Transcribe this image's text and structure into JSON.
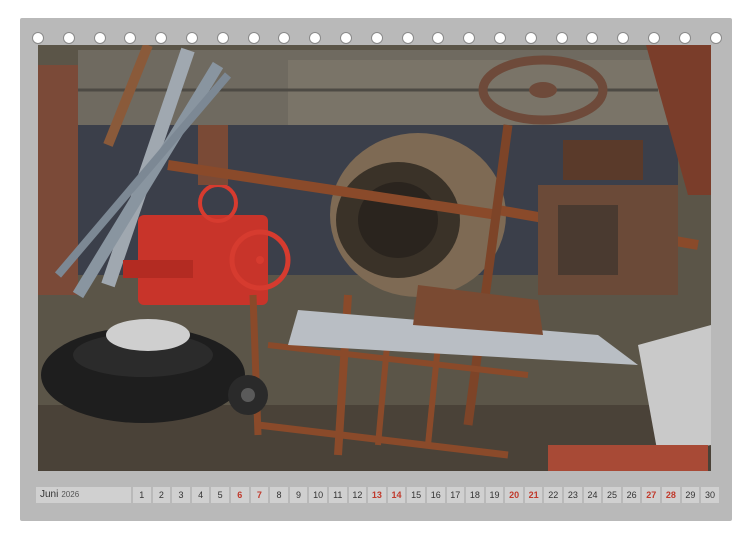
{
  "calendar": {
    "month_label": "Juni",
    "year_label": "2026",
    "days": [
      {
        "num": "1",
        "weekend": false
      },
      {
        "num": "2",
        "weekend": false
      },
      {
        "num": "3",
        "weekend": false
      },
      {
        "num": "4",
        "weekend": false
      },
      {
        "num": "5",
        "weekend": false
      },
      {
        "num": "6",
        "weekend": true
      },
      {
        "num": "7",
        "weekend": true
      },
      {
        "num": "8",
        "weekend": false
      },
      {
        "num": "9",
        "weekend": false
      },
      {
        "num": "10",
        "weekend": false
      },
      {
        "num": "11",
        "weekend": false
      },
      {
        "num": "12",
        "weekend": false
      },
      {
        "num": "13",
        "weekend": true
      },
      {
        "num": "14",
        "weekend": true
      },
      {
        "num": "15",
        "weekend": false
      },
      {
        "num": "16",
        "weekend": false
      },
      {
        "num": "17",
        "weekend": false
      },
      {
        "num": "18",
        "weekend": false
      },
      {
        "num": "19",
        "weekend": false
      },
      {
        "num": "20",
        "weekend": true
      },
      {
        "num": "21",
        "weekend": true
      },
      {
        "num": "22",
        "weekend": false
      },
      {
        "num": "23",
        "weekend": false
      },
      {
        "num": "24",
        "weekend": false
      },
      {
        "num": "25",
        "weekend": false
      },
      {
        "num": "26",
        "weekend": false
      },
      {
        "num": "27",
        "weekend": true
      },
      {
        "num": "28",
        "weekend": true
      },
      {
        "num": "29",
        "weekend": false
      },
      {
        "num": "30",
        "weekend": false
      }
    ],
    "ring_count": 23
  },
  "colors": {
    "frame": "#b9b9b9",
    "weekend": "#c0392b",
    "rust": "#8a4a2a",
    "tire": "#1e1e1e",
    "red_machine": "#c8342a"
  }
}
